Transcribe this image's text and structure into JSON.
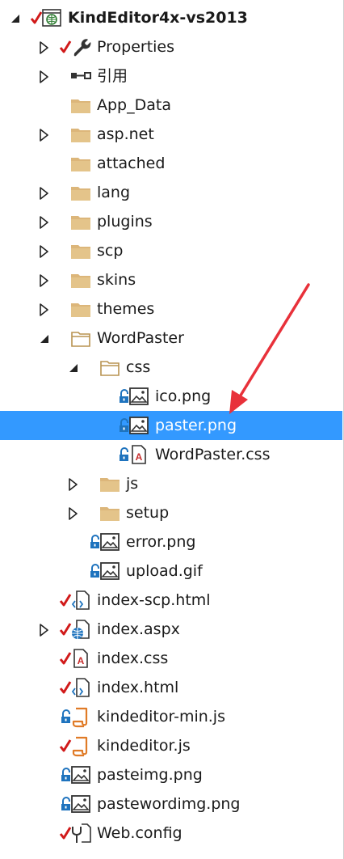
{
  "solution_explorer": {
    "items": [
      {
        "label": "KindEditor4x-vs2013",
        "depth": 0,
        "expander": "expanded",
        "status": "checked",
        "icon": "web-project-icon",
        "bold": true
      },
      {
        "label": "Properties",
        "depth": 1,
        "expander": "collapsed",
        "status": "checked",
        "icon": "wrench-icon"
      },
      {
        "label": "引用",
        "depth": 1,
        "expander": "collapsed",
        "status": "none",
        "icon": "references-icon"
      },
      {
        "label": "App_Data",
        "depth": 1,
        "expander": "none",
        "status": "none",
        "icon": "folder-icon"
      },
      {
        "label": "asp.net",
        "depth": 1,
        "expander": "collapsed",
        "status": "none",
        "icon": "folder-icon"
      },
      {
        "label": "attached",
        "depth": 1,
        "expander": "none",
        "status": "none",
        "icon": "folder-icon"
      },
      {
        "label": "lang",
        "depth": 1,
        "expander": "collapsed",
        "status": "none",
        "icon": "folder-icon"
      },
      {
        "label": "plugins",
        "depth": 1,
        "expander": "collapsed",
        "status": "none",
        "icon": "folder-icon"
      },
      {
        "label": "scp",
        "depth": 1,
        "expander": "collapsed",
        "status": "none",
        "icon": "folder-icon"
      },
      {
        "label": "skins",
        "depth": 1,
        "expander": "collapsed",
        "status": "none",
        "icon": "folder-icon"
      },
      {
        "label": "themes",
        "depth": 1,
        "expander": "collapsed",
        "status": "none",
        "icon": "folder-icon"
      },
      {
        "label": "WordPaster",
        "depth": 1,
        "expander": "expanded",
        "status": "none",
        "icon": "folder-open-icon"
      },
      {
        "label": "css",
        "depth": 2,
        "expander": "expanded",
        "status": "none",
        "icon": "folder-open-icon"
      },
      {
        "label": "ico.png",
        "depth": 3,
        "expander": "none",
        "status": "locked",
        "icon": "image-file-icon"
      },
      {
        "label": "paster.png",
        "depth": 3,
        "expander": "none",
        "status": "locked",
        "icon": "image-file-icon",
        "selected": true
      },
      {
        "label": "WordPaster.css",
        "depth": 3,
        "expander": "none",
        "status": "locked",
        "icon": "css-file-icon"
      },
      {
        "label": "js",
        "depth": 2,
        "expander": "collapsed",
        "status": "none",
        "icon": "folder-icon"
      },
      {
        "label": "setup",
        "depth": 2,
        "expander": "collapsed",
        "status": "none",
        "icon": "folder-icon"
      },
      {
        "label": "error.png",
        "depth": 2,
        "expander": "none",
        "status": "locked",
        "icon": "image-file-icon"
      },
      {
        "label": "upload.gif",
        "depth": 2,
        "expander": "none",
        "status": "locked",
        "icon": "image-file-icon"
      },
      {
        "label": "index-scp.html",
        "depth": 1,
        "expander": "none",
        "status": "checked",
        "icon": "html-file-icon"
      },
      {
        "label": "index.aspx",
        "depth": 1,
        "expander": "collapsed",
        "status": "checked",
        "icon": "aspx-file-icon"
      },
      {
        "label": "index.css",
        "depth": 1,
        "expander": "none",
        "status": "checked",
        "icon": "css-file-icon"
      },
      {
        "label": "index.html",
        "depth": 1,
        "expander": "none",
        "status": "checked",
        "icon": "html-file-icon"
      },
      {
        "label": "kindeditor-min.js",
        "depth": 1,
        "expander": "none",
        "status": "locked",
        "icon": "js-file-icon"
      },
      {
        "label": "kindeditor.js",
        "depth": 1,
        "expander": "none",
        "status": "checked",
        "icon": "js-file-icon"
      },
      {
        "label": "pasteimg.png",
        "depth": 1,
        "expander": "none",
        "status": "locked",
        "icon": "image-file-icon"
      },
      {
        "label": "pastewordimg.png",
        "depth": 1,
        "expander": "none",
        "status": "locked",
        "icon": "image-file-icon"
      },
      {
        "label": "Web.config",
        "depth": 1,
        "expander": "none",
        "status": "checked",
        "icon": "config-file-icon"
      }
    ]
  },
  "colors": {
    "selection": "#3399ff",
    "folder": "#dcb67a",
    "check": "#d11a1a",
    "lock": "#1e73be",
    "arrow": "#e8313a"
  }
}
